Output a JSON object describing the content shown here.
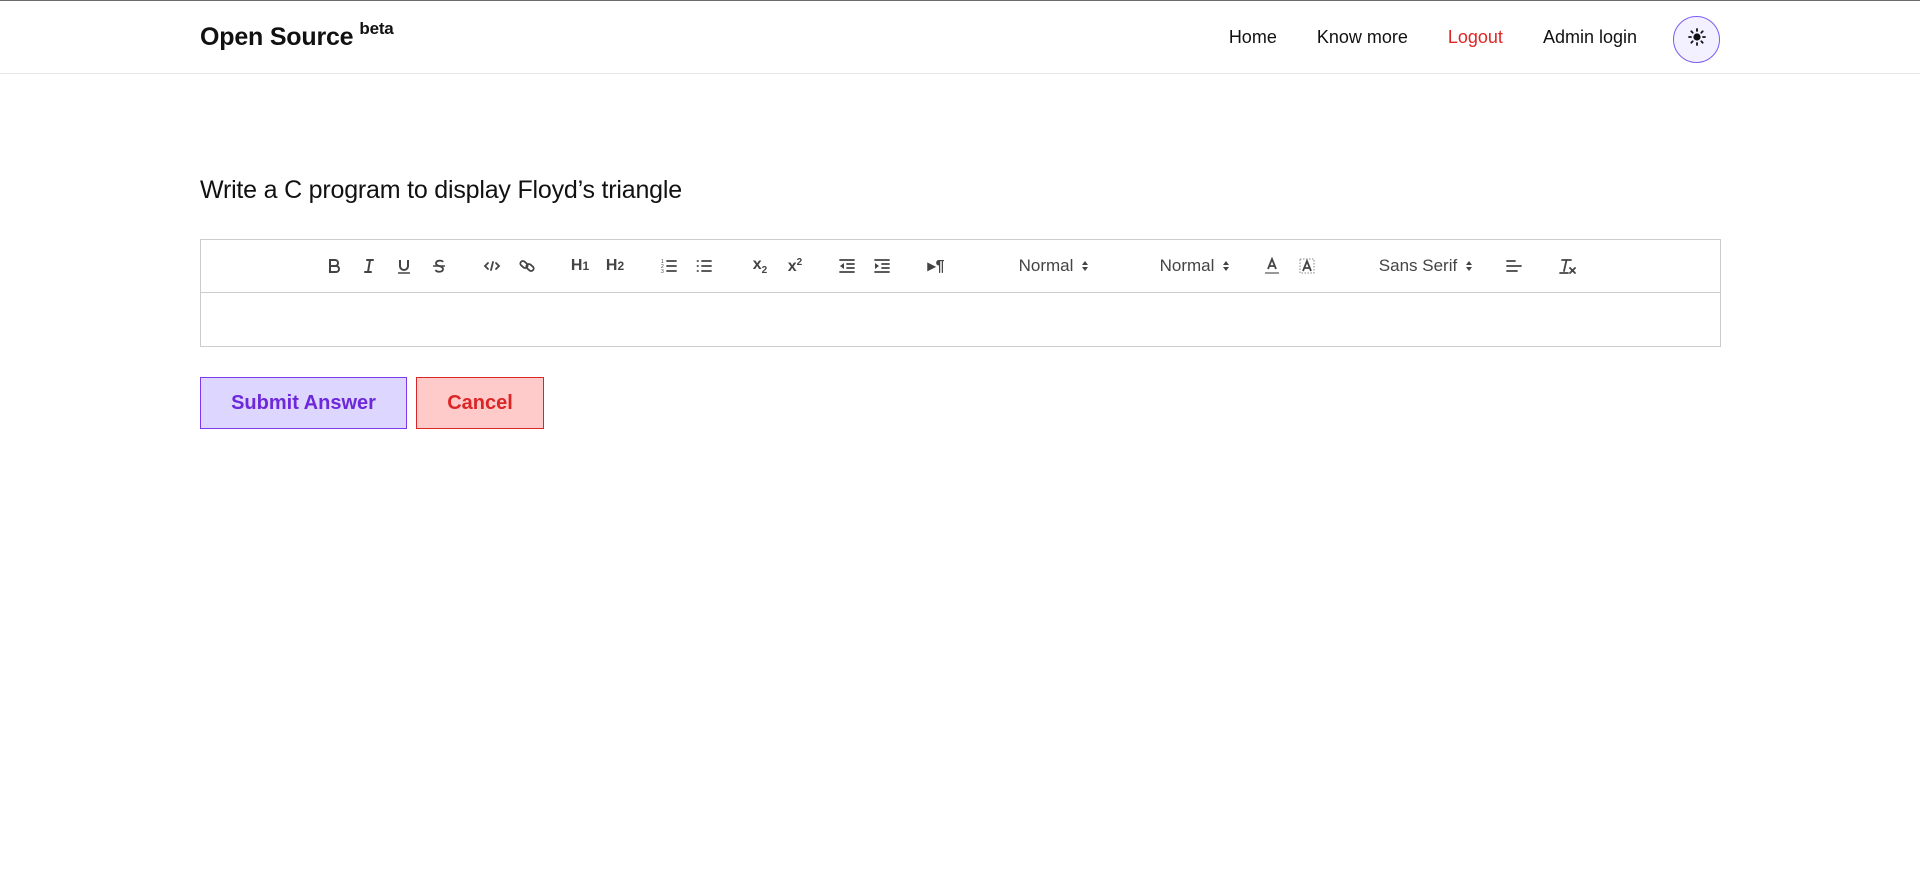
{
  "brand": {
    "title": "Open Source",
    "badge": "beta"
  },
  "nav": {
    "items": [
      {
        "label": "Home"
      },
      {
        "label": "Know more"
      },
      {
        "label": "Logout",
        "color": "#dc2626"
      },
      {
        "label": "Admin login"
      }
    ],
    "theme_toggle_icon": "sun-icon"
  },
  "question": {
    "title": "Write a C program to display Floyd’s triangle"
  },
  "editor": {
    "toolbar": {
      "icons": [
        "bold-icon",
        "italic-icon",
        "underline-icon",
        "strike-icon",
        "code-icon",
        "link-icon",
        "h1-icon",
        "h2-icon",
        "ordered-list-icon",
        "bullet-list-icon",
        "subscript-icon",
        "superscript-icon",
        "outdent-icon",
        "indent-icon",
        "direction-icon",
        "text-color-icon",
        "background-color-icon",
        "align-icon",
        "clear-format-icon"
      ],
      "size_picker": "Normal",
      "header_picker": "Normal",
      "font_picker": "Sans Serif"
    },
    "content": ""
  },
  "actions": {
    "submit_label": "Submit Answer",
    "cancel_label": "Cancel"
  },
  "colors": {
    "accent": "#7c3aed",
    "accent_bg": "#ddd6fe",
    "danger": "#dc2626",
    "danger_bg": "#fecaca"
  }
}
